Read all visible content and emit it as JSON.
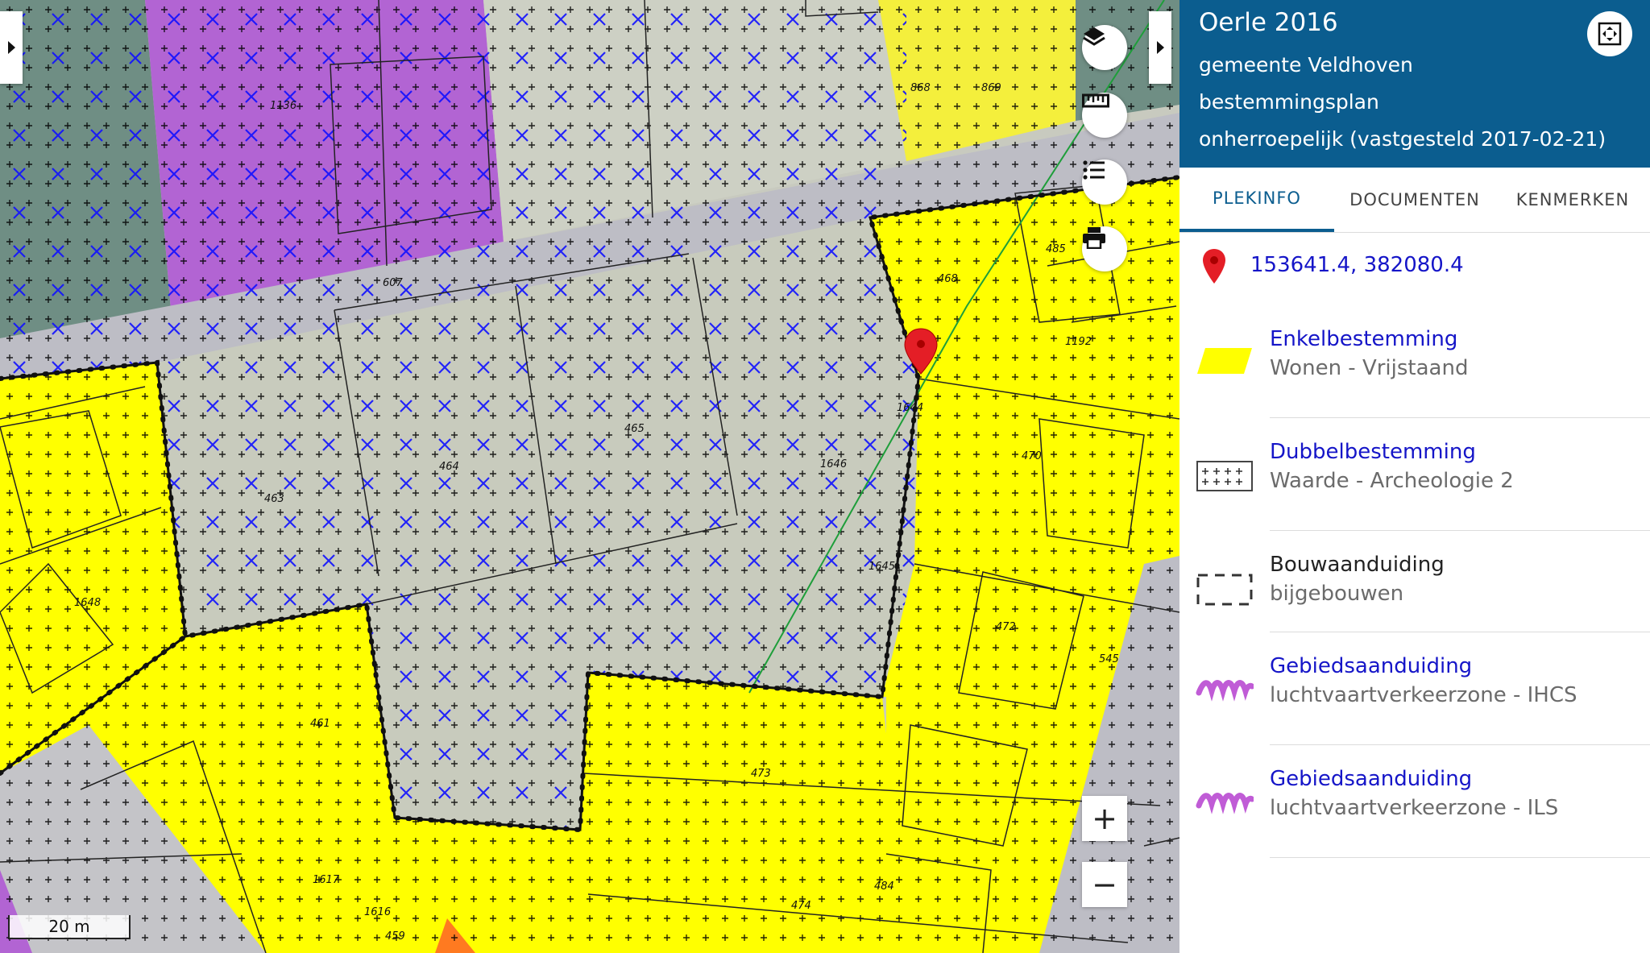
{
  "map": {
    "parcel_numbers": [
      "1136",
      "868",
      "869",
      "607",
      "485",
      "468",
      "1192",
      "1644",
      "465",
      "464",
      "463",
      "1646",
      "470",
      "1648",
      "1645",
      "472",
      "461",
      "545",
      "473",
      "1617",
      "484",
      "1616",
      "474",
      "459"
    ],
    "scale_label": "20 m",
    "zoom_in_label": "+",
    "zoom_out_label": "−",
    "colors": {
      "wonen_vrijstaand": "#ffff00",
      "dubbelbestemming_overlay": "#0000ff",
      "gemengd_purple": "#b060d0",
      "agrarisch_green": "#6e8f84",
      "road_grey": "#bfbfc4",
      "plan_boundary": "#111111",
      "marker": "#e41e26"
    },
    "tools": [
      "layers-icon",
      "ruler-icon",
      "legend-list-icon",
      "print-icon"
    ]
  },
  "panel": {
    "title": "Oerle 2016",
    "municipality": "gemeente Veldhoven",
    "plan_type": "bestemmingsplan",
    "status": "onherroepelijk (vastgesteld 2017-02-21)",
    "tabs": [
      {
        "label": "PLEKINFO",
        "active": true
      },
      {
        "label": "DOCUMENTEN",
        "active": false
      },
      {
        "label": "KENMERKEN",
        "active": false
      }
    ],
    "coordinates": "153641.4, 382080.4",
    "legend": [
      {
        "title": "Enkelbestemming",
        "subtitle": "Wonen - Vrijstaand",
        "linked": true,
        "symbol": "yellow-parallelogram"
      },
      {
        "title": "Dubbelbestemming",
        "subtitle": "Waarde - Archeologie 2",
        "linked": true,
        "symbol": "plus-grid"
      },
      {
        "title": "Bouwaanduiding",
        "subtitle": "bijgebouwen",
        "linked": false,
        "symbol": "dashed-rectangle"
      },
      {
        "title": "Gebiedsaanduiding",
        "subtitle": "luchtvaartverkeerzone - IHCS",
        "linked": true,
        "symbol": "purple-zigzag"
      },
      {
        "title": "Gebiedsaanduiding",
        "subtitle": "luchtvaartverkeerzone - ILS",
        "linked": true,
        "symbol": "purple-zigzag"
      }
    ]
  }
}
